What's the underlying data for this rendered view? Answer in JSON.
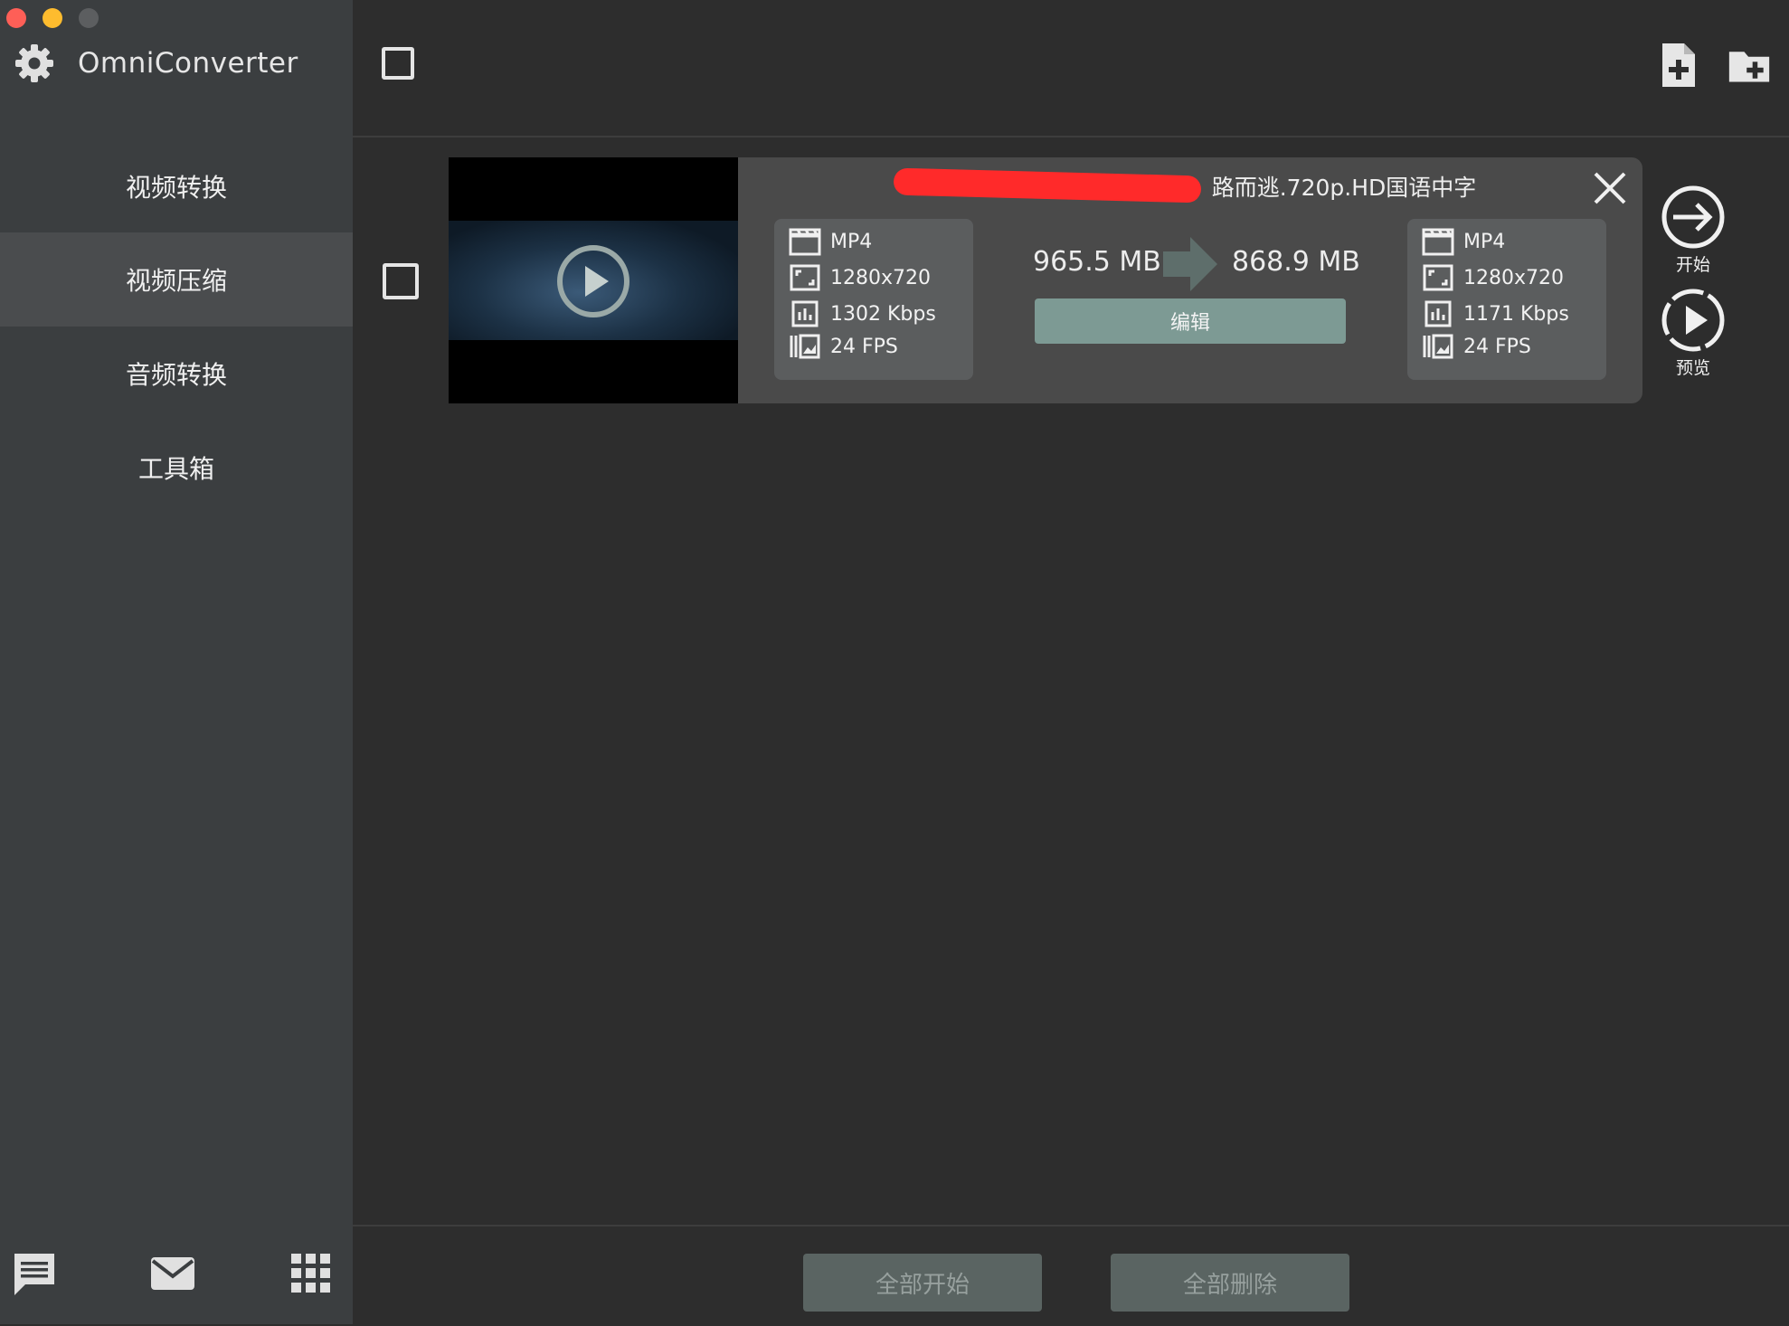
{
  "window": {
    "traffic_lights": [
      "close",
      "minimize",
      "zoom"
    ]
  },
  "app": {
    "title": "OmniConverter",
    "icon": "gear-icon"
  },
  "sidebar": {
    "items": [
      {
        "label": "视频转换",
        "active": false
      },
      {
        "label": "视频压缩",
        "active": true
      },
      {
        "label": "音频转换",
        "active": false
      },
      {
        "label": "工具箱",
        "active": false
      }
    ],
    "bottom_icons": [
      "chat-icon",
      "mail-icon",
      "grid-icon"
    ]
  },
  "header": {
    "select_all_checked": false,
    "icons": [
      "add-file-icon",
      "add-folder-icon"
    ]
  },
  "item": {
    "checked": false,
    "filename": "路而逃.720p.HD国语中字",
    "source": {
      "format": "MP4",
      "resolution": "1280x720",
      "bitrate": "1302 Kbps",
      "fps": "24 FPS"
    },
    "output": {
      "format": "MP4",
      "resolution": "1280x720",
      "bitrate": "1171 Kbps",
      "fps": "24 FPS"
    },
    "size_in": "965.5 MB",
    "size_out": "868.9 MB",
    "edit_label": "编辑",
    "start_label": "开始",
    "preview_label": "预览"
  },
  "footer": {
    "start_all_label": "全部开始",
    "delete_all_label": "全部删除"
  },
  "colors": {
    "sidebar_bg": "#3b3e40",
    "main_bg": "#2d2d2d",
    "card_bg": "#4a4a4a",
    "info_box_bg": "#5b5d5e",
    "accent": "#7d9a94",
    "footer_button": "#5a6462",
    "redaction": "#ff2a2a"
  }
}
